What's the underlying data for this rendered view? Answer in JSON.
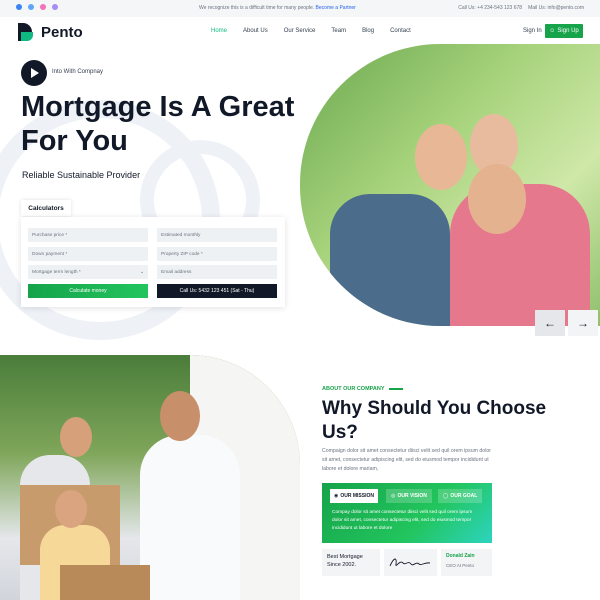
{
  "topbar": {
    "socials": [
      "facebook-icon",
      "twitter-icon",
      "pinterest-icon",
      "instagram-icon"
    ],
    "notice": "We recognize this is a difficult time for many people.",
    "partner_link": "Become a Partner",
    "call": "Call Us: +4 234-543 123 678",
    "mail": "Mail Us: info@pento.com"
  },
  "header": {
    "logo_text": "Pento",
    "nav": [
      "Home",
      "About Us",
      "Our Service",
      "Team",
      "Blog",
      "Contact"
    ],
    "active_nav": "Home",
    "signin": "Sign In",
    "signup": "Sign Up"
  },
  "hero": {
    "intro": "Into With Compnay",
    "title": "Mortgage Is A Great For You",
    "subtitle": "Reliable Sustainable Provider"
  },
  "calculator": {
    "tab": "Calculators",
    "purchase_price": "Purchase price *",
    "estimated_monthly": "Estimated monthly",
    "down_payment": "Down payment *",
    "property_zip": "Property ZIP code *",
    "mortgage_term": "Mortgage term length *",
    "email": "Email address",
    "calculate_btn": "Calculate money",
    "call_btn": "Call Us: 5432 123 451 (Sat - Thu)"
  },
  "slider": {
    "prev": "←",
    "next": "→"
  },
  "about": {
    "kicker": "ABOUT OUR COMPANY",
    "title": "Why Should You Choose Us?",
    "text": "Compaign dolor sit amet consectetur diisci velit sed quil orem ipsum dolor sit amet, consectetur adipiscing elit, sed do eiusmod tempor incididunt ut labore et dolore mariam,",
    "tabs": [
      "OUR MISSION",
      "OUR VISION",
      "OUR GOAL"
    ],
    "tab_text": "Compay dolor sit amet consectetur diisci velit sed quil orem ipsum dolor sit amet, consectetur adipiscing elit, sed do eiusmod tempor incididunt ut labore et dolore",
    "best_mortgage": "Best Mortgage Since 2002.",
    "person_name": "Donald Zain",
    "person_role": "CEO At Pento"
  },
  "colors": {
    "accent": "#16a34a",
    "dark": "#111827"
  }
}
